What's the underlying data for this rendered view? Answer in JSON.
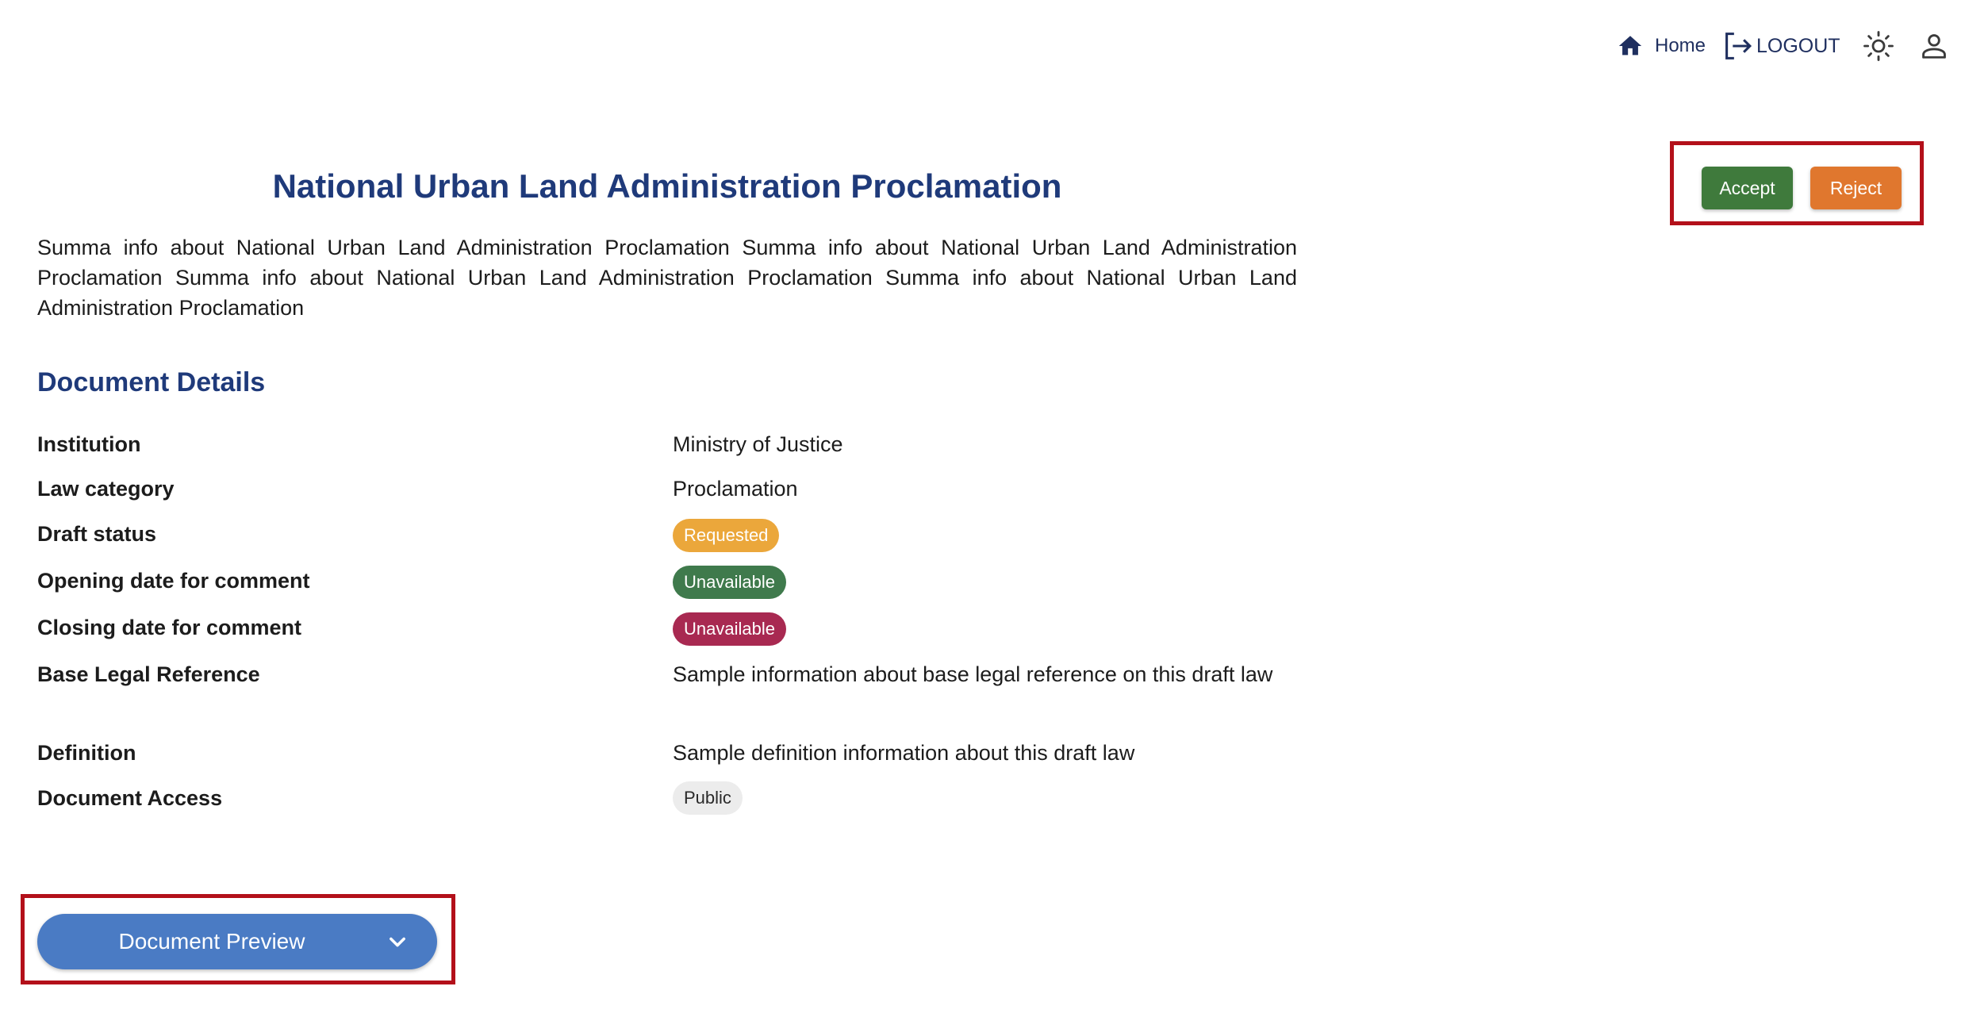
{
  "nav": {
    "home_label": "Home",
    "logout_label": "LOGOUT"
  },
  "document": {
    "title": "National Urban Land Administration Proclamation",
    "summary": "Summa info about National Urban Land Administration Proclamation Summa info about National Urban Land Administration Proclamation Summa info about National Urban Land Administration Proclamation Summa info about National Urban Land Administration Proclamation"
  },
  "actions": {
    "accept_label": "Accept",
    "reject_label": "Reject"
  },
  "details": {
    "heading": "Document Details",
    "institution": {
      "label": "Institution",
      "value": "Ministry of Justice"
    },
    "law_category": {
      "label": "Law category",
      "value": "Proclamation"
    },
    "draft_status": {
      "label": "Draft status",
      "value": "Requested"
    },
    "opening_date": {
      "label": "Opening date for comment",
      "value": "Unavailable"
    },
    "closing_date": {
      "label": "Closing date for comment",
      "value": "Unavailable"
    },
    "base_legal_reference": {
      "label": "Base Legal Reference",
      "value": "Sample information about base legal reference on this draft law"
    },
    "definition": {
      "label": "Definition",
      "value": "Sample definition information about this draft law"
    },
    "document_access": {
      "label": "Document Access",
      "value": "Public"
    }
  },
  "preview": {
    "label": "Document Preview"
  },
  "colors": {
    "title": "#1f3a7a",
    "accept": "#3f7a3c",
    "reject": "#e0772e",
    "requested": "#eba73b",
    "opening_unavailable": "#3f7a4c",
    "closing_unavailable": "#a82951",
    "preview_button": "#4a7bc4",
    "highlight_frame": "#b3101a"
  },
  "icons": {
    "home": "home-icon",
    "logout": "logout-icon",
    "theme": "sun-icon",
    "user": "user-icon",
    "preview": "chevron-down-icon"
  }
}
